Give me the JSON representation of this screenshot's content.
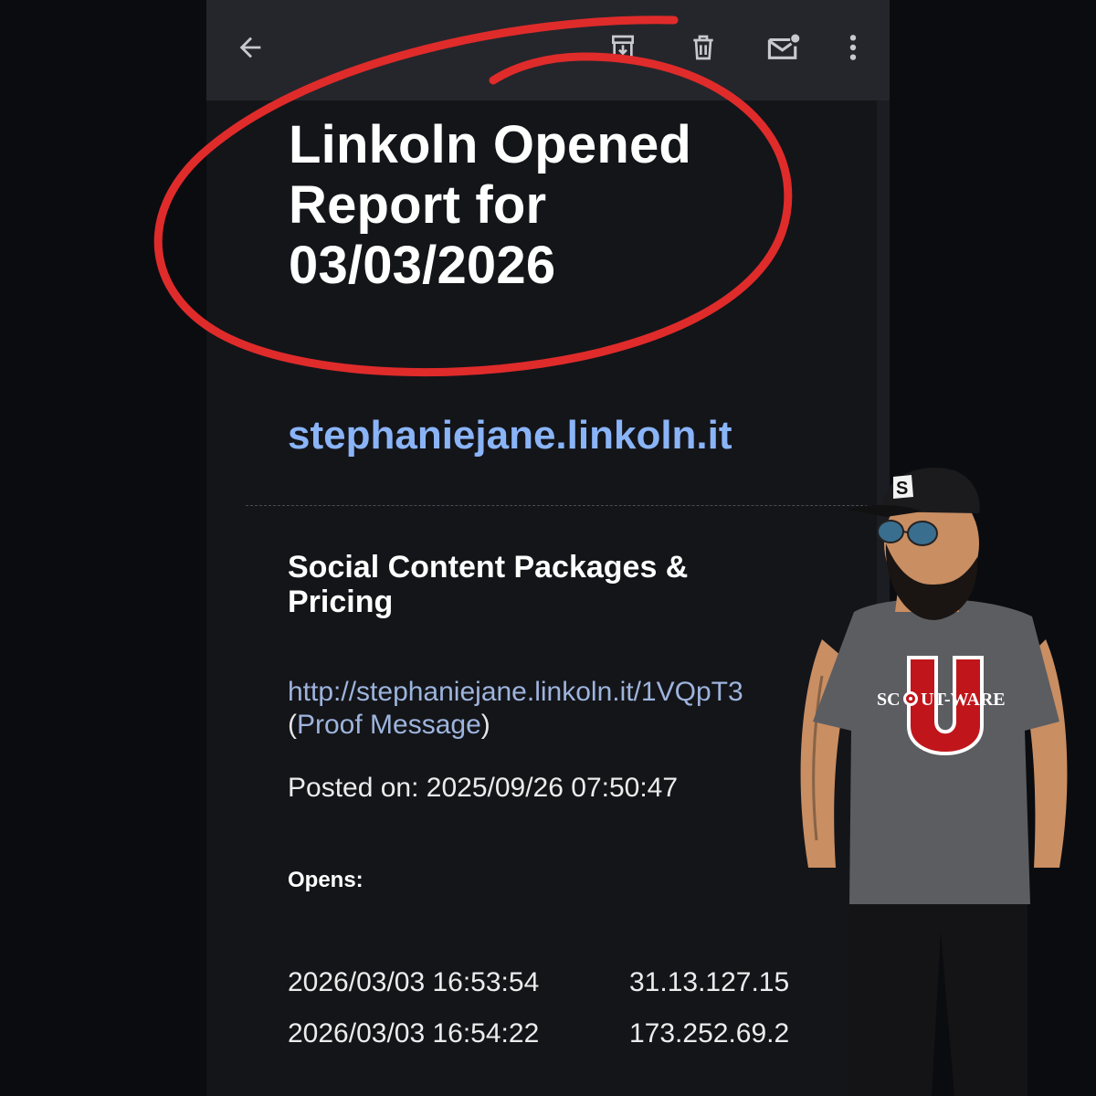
{
  "toolbar": {
    "icons": [
      "back-arrow-icon",
      "archive-icon",
      "delete-icon",
      "mark-unread-icon",
      "more-vert-icon"
    ]
  },
  "email": {
    "title": "Linkoln Opened Report for 03/03/2026",
    "domain": "stephaniejane.linkoln.it",
    "subject": "Social Content Packages & Pricing",
    "link_url": "http://stephaniejane.linkoln.it/1VQpT3",
    "proof_open_paren": "(",
    "proof_label": "Proof Message",
    "proof_close_paren": ")",
    "posted_on": "Posted on: 2025/09/26 07:50:47",
    "opens_label": "Opens:",
    "opens": [
      {
        "timestamp": "2026/03/03 16:53:54",
        "ip": "31.13.127.15"
      },
      {
        "timestamp": "2026/03/03 16:54:22",
        "ip": "173.252.69.2"
      }
    ]
  },
  "mascot": {
    "cap_letter": "S",
    "shirt_brand_left": "SC",
    "shirt_brand_right": "UT-WARE",
    "shirt_letter": "U"
  },
  "colors": {
    "background": "#0b0c10",
    "toolbar": "#25262b",
    "link": "#8ab4f8",
    "annotation_red": "#e02b2b"
  }
}
